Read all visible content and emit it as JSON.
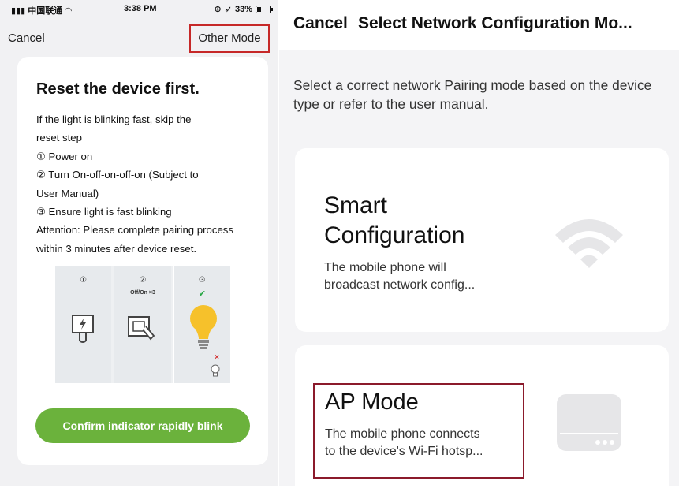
{
  "status_bar": {
    "carrier": "中国联通",
    "time": "3:38 PM",
    "battery": "33%"
  },
  "left": {
    "nav": {
      "cancel_label": "Cancel",
      "other_mode_label": "Other Mode"
    },
    "card": {
      "title": "Reset the device first.",
      "lines": [
        "If the light is blinking fast, skip the",
        "reset step",
        "① Power on",
        "② Turn On-off-on-off-on (Subject to",
        "User Manual)",
        "③ Ensure light is fast blinking",
        "Attention: Please complete pairing process",
        "within 3 minutes after device reset."
      ],
      "illustration": {
        "steps": [
          "①",
          "②",
          "③"
        ],
        "step2_caption": "Off/On ×3",
        "step3_check": "✔",
        "step3_cross": "×"
      },
      "confirm_label": "Confirm indicator rapidly blink"
    }
  },
  "right": {
    "header": {
      "cancel_label": "Cancel",
      "title": "Select Network Configuration Mo..."
    },
    "description": "Select a correct network Pairing mode based on the device type or refer to the user manual.",
    "modes": [
      {
        "title_line1": "Smart",
        "title_line2": "Configuration",
        "desc_line1": "The mobile phone will",
        "desc_line2": "broadcast network config...",
        "icon": "wifi-icon"
      },
      {
        "title": "AP Mode",
        "desc_line1": "The mobile phone connects",
        "desc_line2": "to the device's Wi-Fi hotsp...",
        "icon": "router-icon"
      }
    ]
  },
  "colors": {
    "confirm_green": "#6bb23c",
    "highlight_red": "#c62828",
    "highlight_darkred": "#8b1a2b",
    "icon_gray": "#e6e6e8"
  }
}
